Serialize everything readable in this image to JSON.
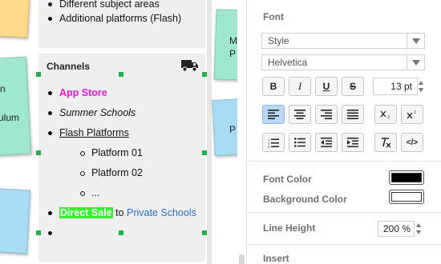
{
  "canvas": {
    "top_list": [
      "Different subject areas",
      "Additional platforms (Flash)"
    ],
    "notes": {
      "left_green_text_1": "n",
      "left_green_text_2": "ulum",
      "right_green_text_1": "M",
      "right_green_text_2": "P",
      "right_blue_text": "P"
    },
    "channels": {
      "title": "Channels",
      "truck_icon": "truck-icon",
      "items": {
        "app_store": "App Store",
        "summer": "Summer Schools",
        "flash": "Flash Platforms",
        "platform1": "Platform 01",
        "platform2": "Platform 02",
        "ellipsis": "...",
        "direct_sale": "Direct Sale",
        "to": " to ",
        "private_schools": "Private Schools"
      }
    },
    "colors": {
      "app_store": "#e51bd9",
      "direct_sale_bg": "#36f02f",
      "private_schools": "#2a6fd6",
      "selection_handle": "#22b14c"
    }
  },
  "format_panel": {
    "font_section_title": "Font",
    "style_select": "Style",
    "font_family_select": "Helvetica",
    "font_size": "13 pt",
    "buttons": {
      "bold": "B",
      "italic": "I",
      "underline": "U",
      "strikethrough": "S",
      "code": "</>"
    },
    "active_alignment": "align-left",
    "font_color_label": "Font Color",
    "font_color": "#000000",
    "background_color_label": "Background Color",
    "background_color": "#ffffff",
    "line_height_label": "Line Height",
    "line_height_value": "200 %",
    "insert_label": "Insert"
  }
}
